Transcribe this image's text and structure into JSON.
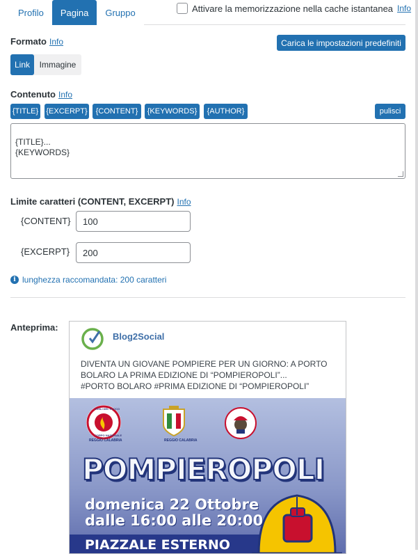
{
  "tabs": [
    {
      "label": "Profilo",
      "active": false
    },
    {
      "label": "Pagina",
      "active": true
    },
    {
      "label": "Gruppo",
      "active": false
    }
  ],
  "cache": {
    "label": "Attivare la memorizzazione nella cache istantanea",
    "info": "Info",
    "checked": false
  },
  "formato": {
    "label": "Formato",
    "info": "Info",
    "default_button": "Carica le impostazioni predefiniti",
    "options": [
      "Link",
      "Immagine"
    ],
    "selected": "Link"
  },
  "contenuto": {
    "label": "Contenuto",
    "info": "Info",
    "tags": [
      "{TITLE}",
      "{EXCERPT}",
      "{CONTENT}",
      "{KEYWORDS}",
      "{AUTHOR}"
    ],
    "clear_button": "pulisci",
    "value": "{TITLE}...\n{KEYWORDS}"
  },
  "limite": {
    "label": "Limite caratteri (CONTENT, EXCERPT)",
    "info": "Info",
    "content_label": "{CONTENT}",
    "content_value": "100",
    "excerpt_label": "{EXCERPT}",
    "excerpt_value": "200",
    "hint": "lunghezza raccomandata: 200 caratteri"
  },
  "anteprima": {
    "label": "Anteprima:",
    "brand": "Blog2Social",
    "text_lines": [
      "DIVENTA UN GIOVANE POMPIERE PER UN GIORNO: A PORTO",
      "BOLARO LA PRIMA EDIZIONE DI “POMPIEROPOLI”...",
      "#PORTO BOLARO #PRIMA EDIZIONE DI “POMPIEROPOLI”"
    ],
    "poster": {
      "badge1_top": "VIGILI DEL FUOCO",
      "badge1_bottom": "CORPO NAZIONALE",
      "badge1_sub": "REGGIO CALABRIA",
      "badge2_sub": "REGGIO CALABRIA",
      "title": "POMPIEROPOLI",
      "date_line1": "domenica 22 Ottobre",
      "date_line2": "dalle 16:00 alle 20:00",
      "location": "PIAZZALE ESTERNO"
    }
  },
  "colors": {
    "accent": "#2271b1",
    "poster_blue": "#27388a"
  }
}
